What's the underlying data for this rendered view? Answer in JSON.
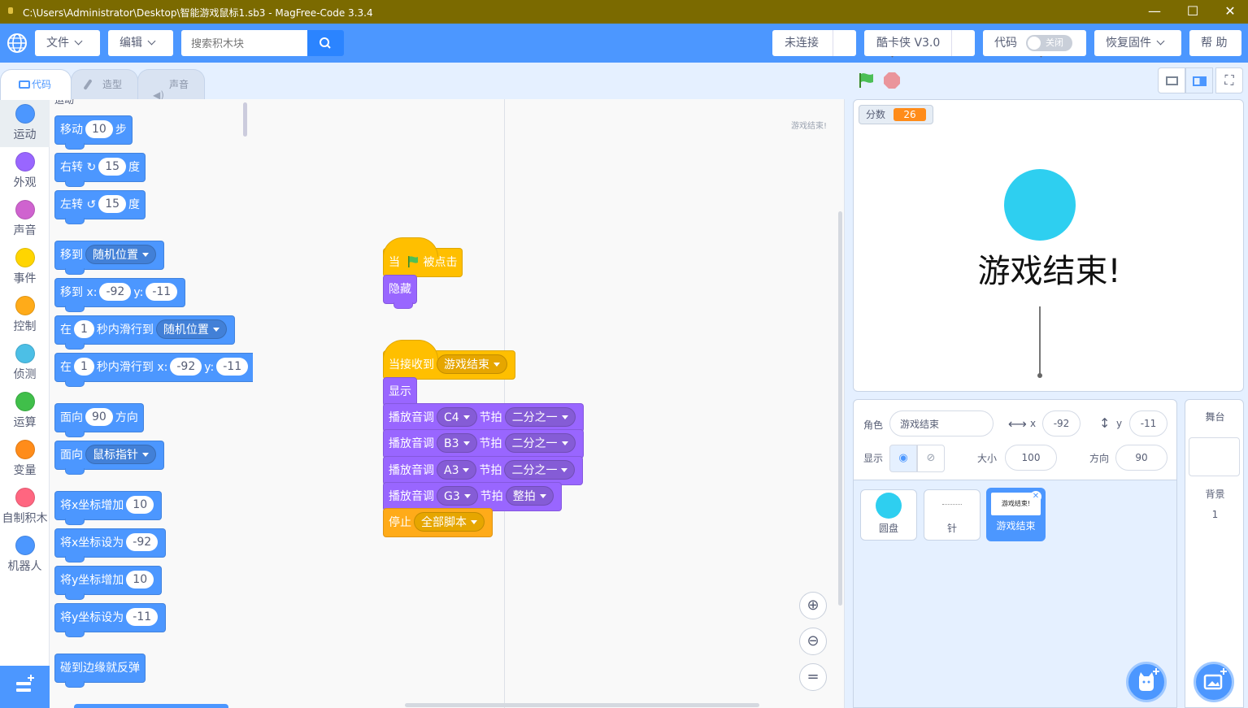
{
  "window": {
    "title": "C:\\Users\\Administrator\\Desktop\\智能游戏鼠标1.sb3 - MagFree-Code 3.3.4"
  },
  "menubar": {
    "file": "文件",
    "edit": "编辑",
    "search_placeholder": "搜索积木块",
    "connection": "未连接",
    "device": "酷卡侠 V3.0",
    "code_label": "代码",
    "code_toggle": "关闭",
    "restore": "恢复固件",
    "help": "帮 助"
  },
  "tabs": [
    "代码",
    "造型",
    "声音"
  ],
  "categories": [
    {
      "label": "运动",
      "color": "#4c97ff"
    },
    {
      "label": "外观",
      "color": "#9966ff"
    },
    {
      "label": "声音",
      "color": "#cf63cf"
    },
    {
      "label": "事件",
      "color": "#ffd500"
    },
    {
      "label": "控制",
      "color": "#ffab19"
    },
    {
      "label": "侦测",
      "color": "#4cbfe6"
    },
    {
      "label": "运算",
      "color": "#40bf4a"
    },
    {
      "label": "变量",
      "color": "#ff8c1a"
    },
    {
      "label": "自制积木",
      "color": "#ff6680"
    },
    {
      "label": "机器人",
      "color": "#4c97ff"
    }
  ],
  "palette": {
    "section": "运动",
    "move": {
      "a": "移动",
      "v": "10",
      "b": "步"
    },
    "turn_right": {
      "a": "右转",
      "v": "15",
      "b": "度"
    },
    "turn_left": {
      "a": "左转",
      "v": "15",
      "b": "度"
    },
    "goto": {
      "a": "移到",
      "d": "随机位置"
    },
    "goto_xy": {
      "a": "移到 x:",
      "x": "-92",
      "b": "y:",
      "y": "-11"
    },
    "glide": {
      "a": "在",
      "v": "1",
      "b": "秒内滑行到",
      "d": "随机位置"
    },
    "glide_xy": {
      "a": "在",
      "v": "1",
      "b": "秒内滑行到 x:",
      "x": "-92",
      "c": "y:",
      "y": "-11"
    },
    "point_dir": {
      "a": "面向",
      "v": "90",
      "b": "方向"
    },
    "point_to": {
      "a": "面向",
      "d": "鼠标指针"
    },
    "change_x": {
      "a": "将x坐标增加",
      "v": "10"
    },
    "set_x": {
      "a": "将x坐标设为",
      "v": "-92"
    },
    "change_y": {
      "a": "将y坐标增加",
      "v": "10"
    },
    "set_y": {
      "a": "将y坐标设为",
      "v": "-11"
    },
    "bounce": "碰到边缘就反弹"
  },
  "workspace": {
    "sprite_watermark": "游戏结束!",
    "script1": {
      "when": "当",
      "clicked": "被点击",
      "hide": "隐藏"
    },
    "script2": {
      "receive": "当接收到",
      "msg": "游戏结束",
      "show": "显示",
      "play": "播放音调",
      "beat": "节拍",
      "notes": [
        {
          "note": "C4",
          "beat": "二分之一"
        },
        {
          "note": "B3",
          "beat": "二分之一"
        },
        {
          "note": "A3",
          "beat": "二分之一"
        },
        {
          "note": "G3",
          "beat": "整拍"
        }
      ],
      "stop": "停止",
      "stop_opt": "全部脚本"
    }
  },
  "stage": {
    "var_name": "分数",
    "var_value": "26",
    "text": "游戏结束!",
    "circle_color": "#2ecff0"
  },
  "sprite_info": {
    "sprite_label": "角色",
    "sprite_name": "游戏结束",
    "x_label": "x",
    "x": "-92",
    "y_label": "y",
    "y": "-11",
    "show_label": "显示",
    "size_label": "大小",
    "size": "100",
    "dir_label": "方向",
    "dir": "90"
  },
  "sprites": [
    {
      "name": "圆盘"
    },
    {
      "name": "针"
    },
    {
      "name": "游戏结束",
      "thumb": "游戏结束!"
    }
  ],
  "stage_panel": {
    "title": "舞台",
    "backdrop_label": "背景",
    "backdrop_count": "1"
  }
}
